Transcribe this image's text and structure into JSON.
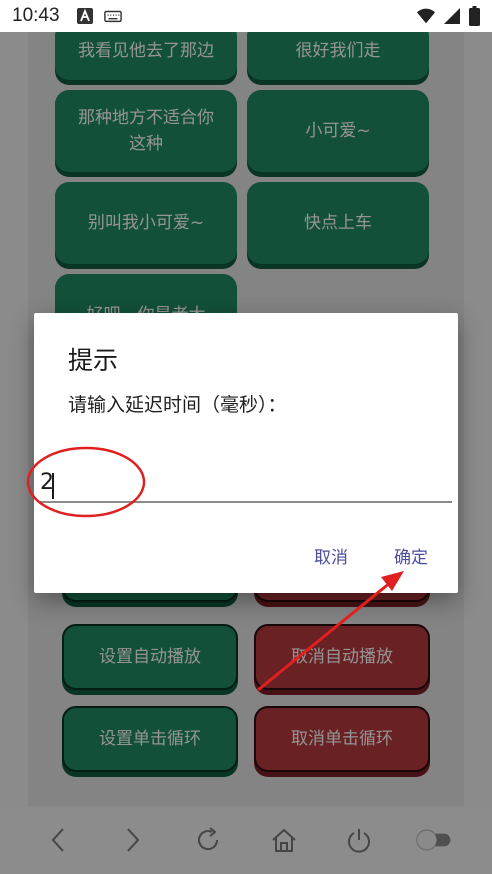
{
  "status_bar": {
    "time": "10:43"
  },
  "grid_buttons": [
    {
      "label": "我看见他去了那边",
      "color": "green"
    },
    {
      "label": "很好我们走",
      "color": "green"
    },
    {
      "label": "那种地方不适合你\n这种",
      "color": "green"
    },
    {
      "label": "小可爱~",
      "color": "green"
    },
    {
      "label": "别叫我小可爱~",
      "color": "green"
    },
    {
      "label": "快点上车",
      "color": "green"
    },
    {
      "label": "好吧，你是老大",
      "color": "green"
    }
  ],
  "control_buttons": {
    "set_autoplay": "设置自动播放",
    "cancel_autoplay": "取消自动播放",
    "set_single_loop": "设置单击循环",
    "cancel_single_loop": "取消单击循环"
  },
  "dialog": {
    "title": "提示",
    "message": "请输入延迟时间（毫秒）：",
    "input_value": "2",
    "cancel_label": "取消",
    "ok_label": "确定"
  },
  "icons": {
    "back": "chevron-left-icon",
    "forward": "chevron-right-icon",
    "refresh": "refresh-icon",
    "home": "home-icon",
    "power": "power-icon",
    "toggle": "toggle-icon"
  },
  "colors": {
    "green": "#1f8a63",
    "red": "#b53a3f",
    "annotation": "#e02020",
    "dialog_action": "#4b4ba0"
  }
}
